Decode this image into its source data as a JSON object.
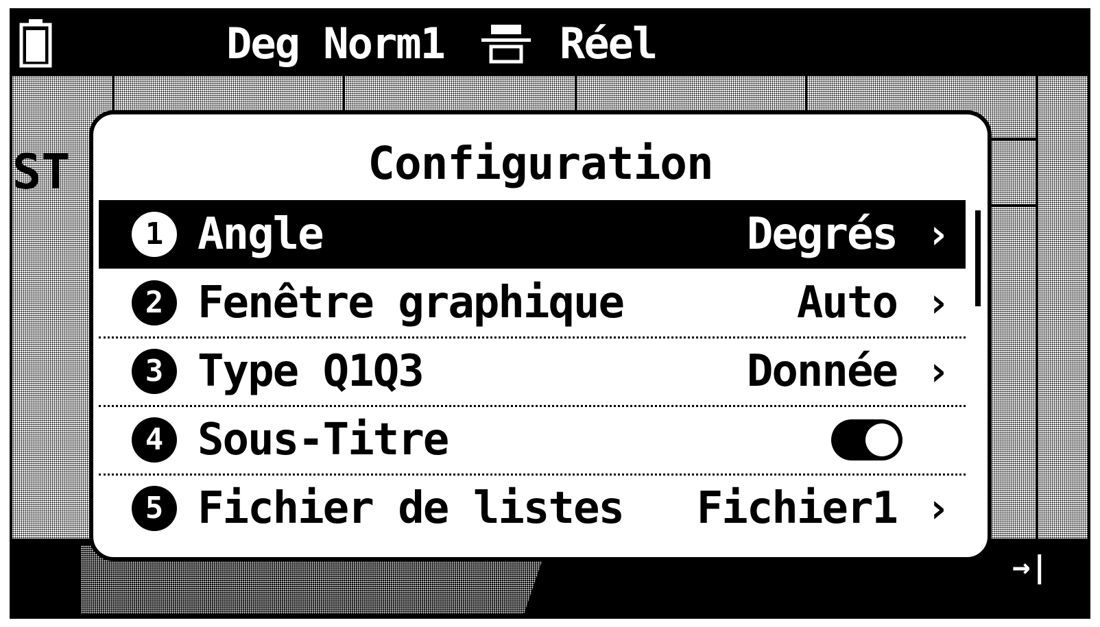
{
  "status_bar": {
    "mode": "Deg Norm1",
    "number_format": "Réel",
    "battery_icon": "battery-icon",
    "format_icon": "display-format-icon"
  },
  "background": {
    "side_label": "ST"
  },
  "dialog": {
    "title": "Configuration",
    "items": [
      {
        "number": "1",
        "label": "Angle",
        "value": "Degrés",
        "selected": true,
        "has_chevron": true
      },
      {
        "number": "2",
        "label": "Fenêtre graphique",
        "value": "Auto",
        "selected": false,
        "has_chevron": true
      },
      {
        "number": "3",
        "label": "Type Q1Q3",
        "value": "Donnée",
        "selected": false,
        "has_chevron": true
      },
      {
        "number": "4",
        "label": "Sous-Titre",
        "toggle_on": true,
        "selected": false,
        "has_chevron": false
      },
      {
        "number": "5",
        "label": "Fichier de listes",
        "value": "Fichier1",
        "selected": false,
        "has_chevron": true
      }
    ],
    "chevron": "›"
  },
  "bottom_bar": {
    "end_icon": "→|"
  }
}
